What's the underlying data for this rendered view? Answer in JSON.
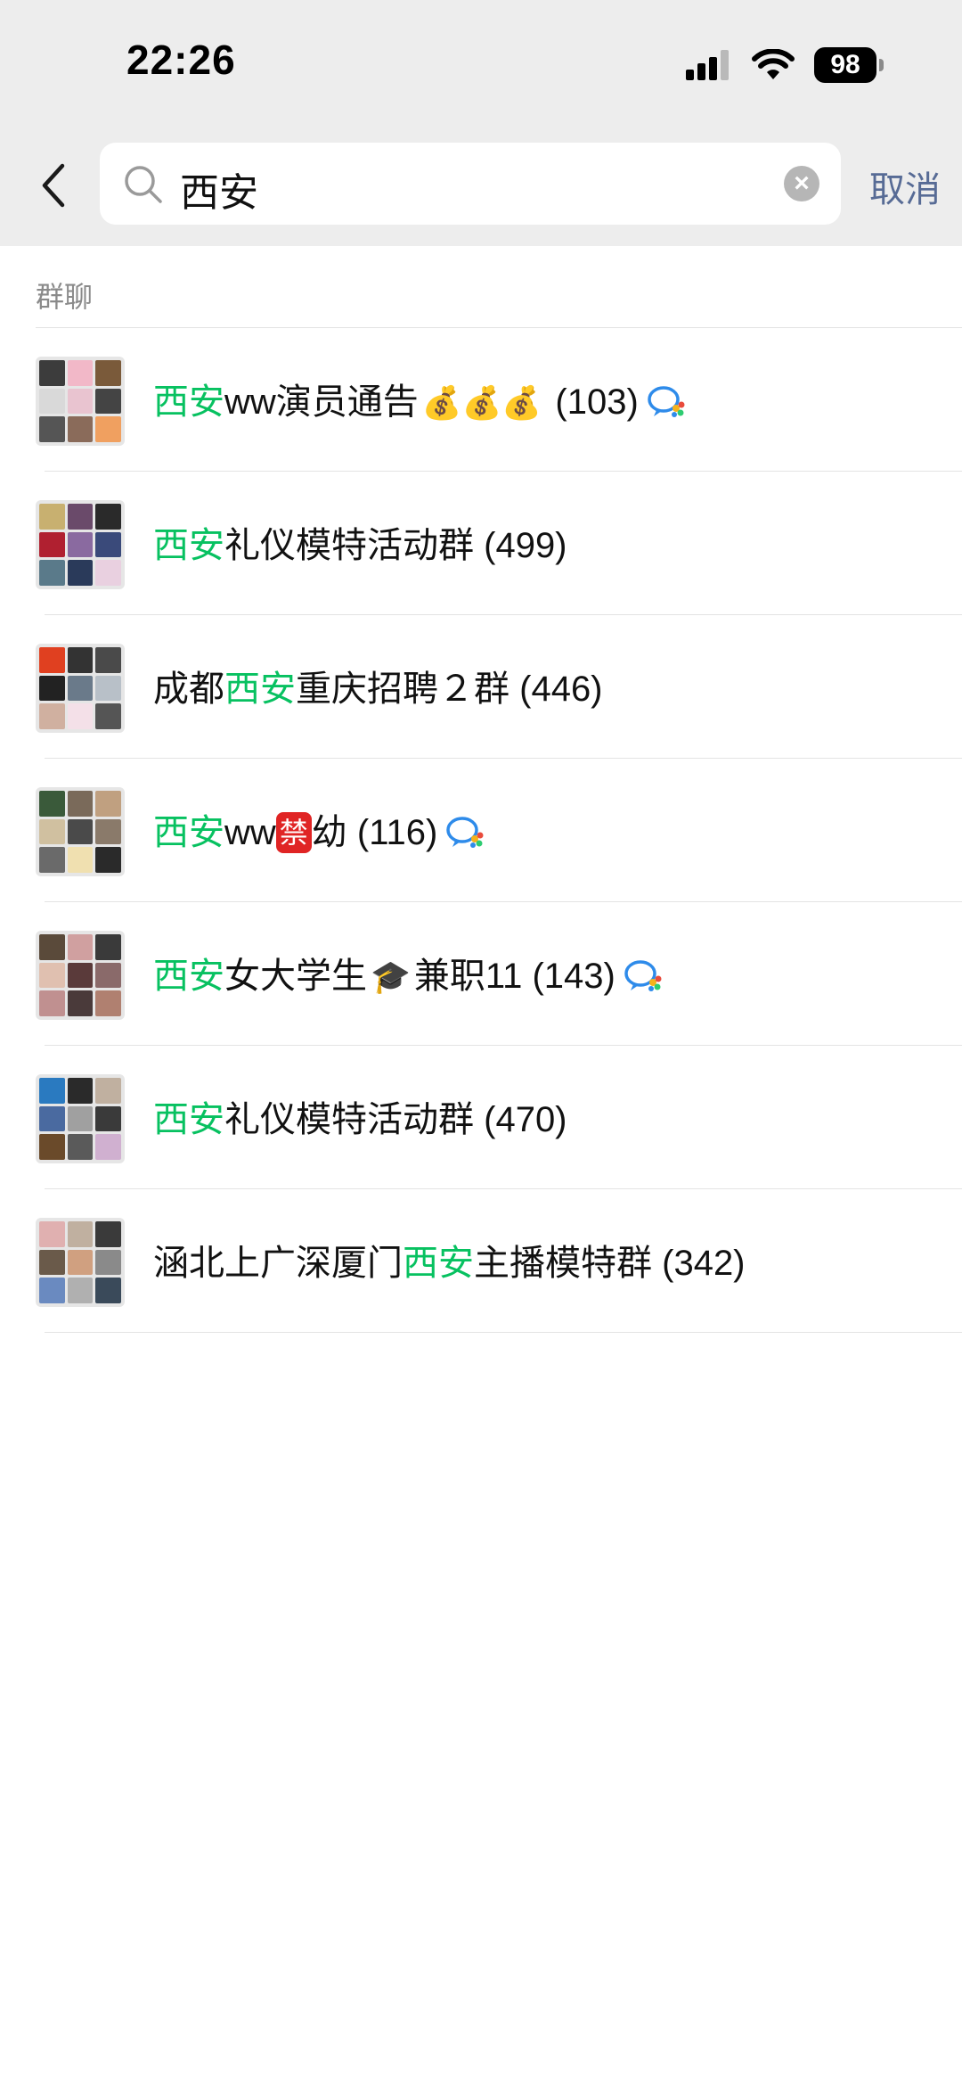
{
  "status": {
    "time": "22:26",
    "battery": "98"
  },
  "search": {
    "query": "西安",
    "cancel_label": "取消"
  },
  "section": {
    "title": "群聊"
  },
  "results": [
    {
      "pre": "",
      "hl": "西安",
      "post": "ww演员通告",
      "emoji": "💰💰💰",
      "count": "(103)",
      "wecom": true
    },
    {
      "pre": "",
      "hl": "西安",
      "post": "礼仪模特活动群",
      "emoji": "",
      "count": "(499)",
      "wecom": false
    },
    {
      "pre": "成都",
      "hl": "西安",
      "post": "重庆招聘２群",
      "emoji": "",
      "count": "(446)",
      "wecom": false
    },
    {
      "pre": "",
      "hl": "西安",
      "post": "ww",
      "badge": "禁",
      "post2": "幼",
      "count": "(116)",
      "wecom": true
    },
    {
      "pre": "",
      "hl": "西安",
      "post": "女大学生",
      "emoji": "🎓",
      "post2": "兼职11",
      "count": "(143)",
      "wecom": true
    },
    {
      "pre": "",
      "hl": "西安",
      "post": "礼仪模特活动群",
      "emoji": "",
      "count": "(470)",
      "wecom": false
    },
    {
      "pre": "涵北上广深厦门",
      "hl": "西安",
      "post": "主播模特群",
      "emoji": "",
      "count": "(342)",
      "wecom": false
    }
  ],
  "colors": {
    "highlight": "#07c160",
    "link": "#576b95",
    "badge_red": "#e02424"
  }
}
